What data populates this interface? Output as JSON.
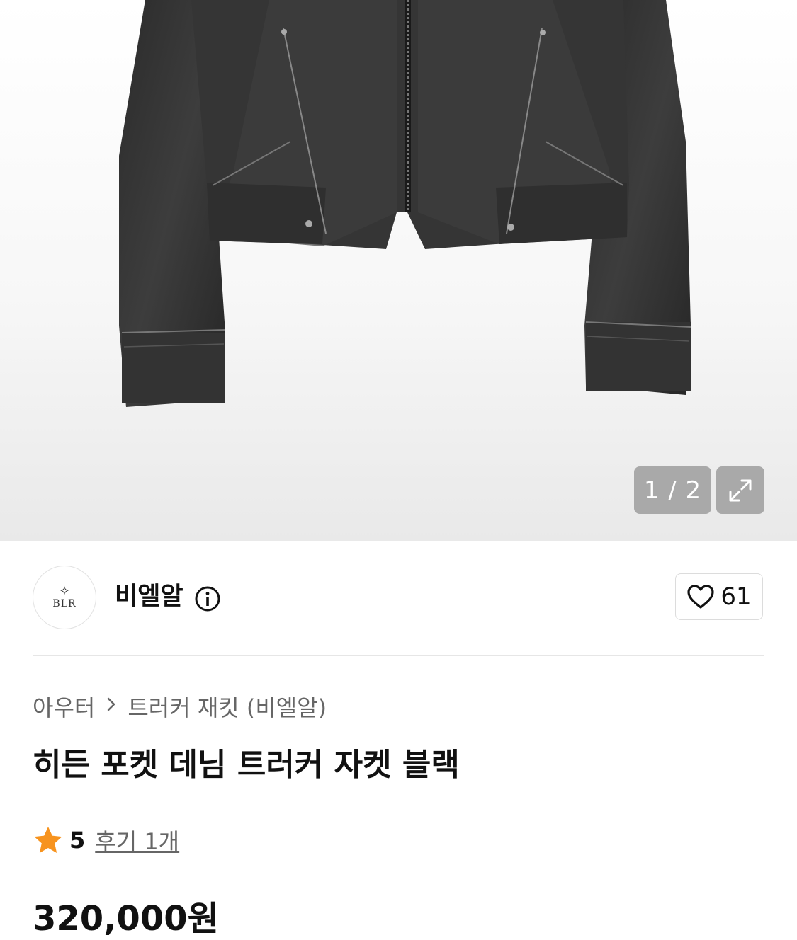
{
  "image": {
    "counter": "1 / 2",
    "expand_icon": "expand-arrows-icon"
  },
  "brand": {
    "logo_text": "BLR",
    "name": "비엘알",
    "info_icon": "info-icon"
  },
  "like": {
    "icon": "heart-outline-icon",
    "count": "61"
  },
  "breadcrumb": {
    "category": "아우터",
    "separator_icon": "chevron-right-icon",
    "subcategory": "트러커 재킷 (비엘알)"
  },
  "product": {
    "title": "히든 포켓 데님 트러커 자켓 블랙",
    "rating": "5",
    "review_link": "후기 1개",
    "price": "320,000원"
  },
  "colors": {
    "star": "#F7931E",
    "text": "#111111",
    "muted": "#666666"
  }
}
